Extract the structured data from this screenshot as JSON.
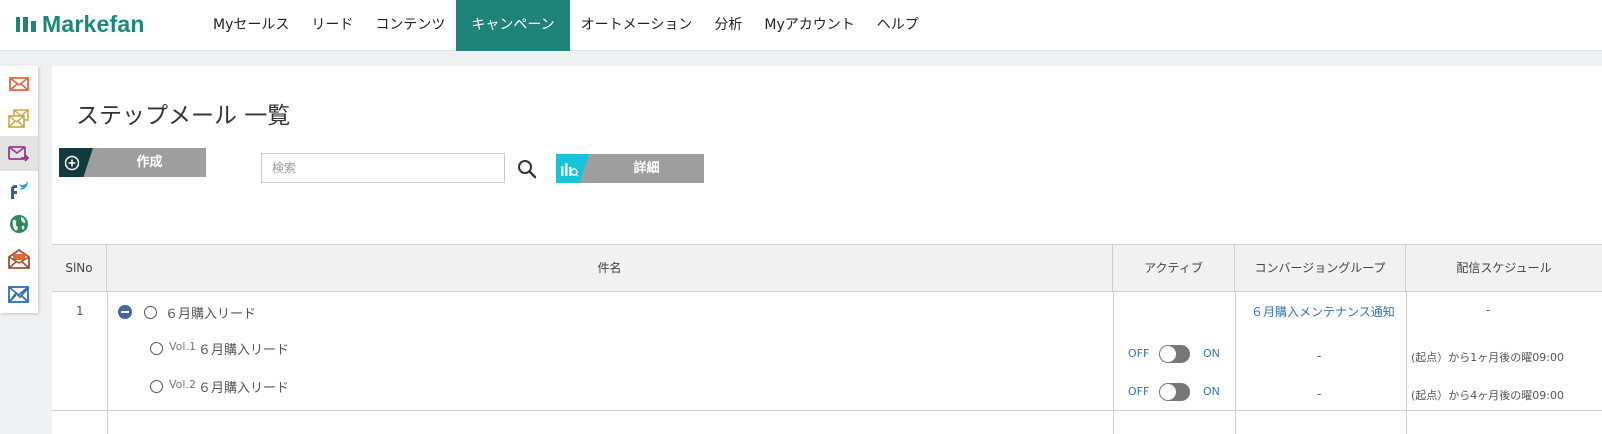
{
  "brand": {
    "name": "Markefan",
    "color": "#1a8a78"
  },
  "nav": {
    "active_color": "#20837a",
    "items": [
      {
        "label": "Myセールス"
      },
      {
        "label": "リード"
      },
      {
        "label": "コンテンツ"
      },
      {
        "label": "キャンペーン",
        "active": true
      },
      {
        "label": "オートメーション"
      },
      {
        "label": "分析"
      },
      {
        "label": "Myアカウント"
      },
      {
        "label": "ヘルプ"
      }
    ]
  },
  "rail": {
    "items": [
      {
        "icon": "mail-icon",
        "color": "#e2673a"
      },
      {
        "icon": "mail-multiple-icon",
        "color": "#c9a641"
      },
      {
        "icon": "mail-send-icon",
        "color": "#9a3a8e",
        "active": true
      },
      {
        "icon": "social-facebook-twitter-icon",
        "color": "#1da1f2"
      },
      {
        "icon": "globe-icon",
        "color": "#2e8b57"
      },
      {
        "icon": "mail-open-icon",
        "color": "#a0522d"
      },
      {
        "icon": "mail-chart-icon",
        "color": "#2a6fb5"
      }
    ]
  },
  "page": {
    "title": "ステップメール 一覧",
    "create_label": "作成",
    "search_placeholder": "検索",
    "detail_label": "詳細"
  },
  "table": {
    "columns": [
      "SlNo",
      "件名",
      "アクティブ",
      "コンバージョングループ",
      "配信スケジュール"
    ],
    "rows": [
      {
        "no": "1",
        "name": "６月購入リード",
        "conversion_group": "６月購入メンテナンス通知",
        "schedule": "-",
        "children": [
          {
            "vol": "Vol.1",
            "name": "６月購入リード",
            "off": "OFF",
            "on": "ON",
            "active": false,
            "conversion_group": "-",
            "schedule": "(起点）から1ヶ月後の曜09:00"
          },
          {
            "vol": "Vol.2",
            "name": "６月購入リード",
            "off": "OFF",
            "on": "ON",
            "active": false,
            "conversion_group": "-",
            "schedule": "(起点）から4ヶ月後の曜09:00"
          }
        ]
      }
    ]
  }
}
